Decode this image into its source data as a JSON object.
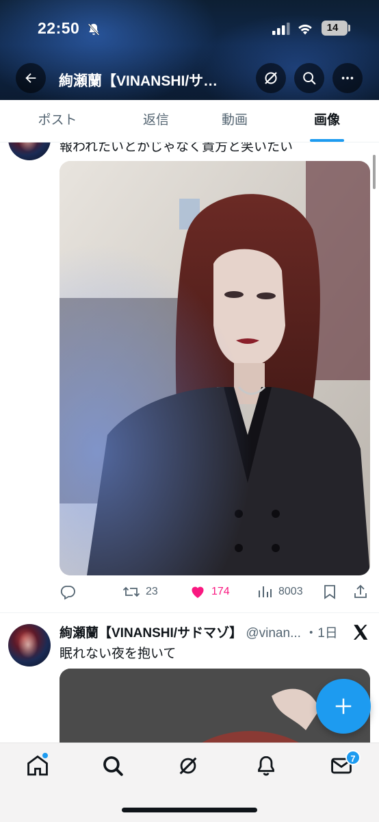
{
  "status_bar": {
    "time": "22:50",
    "battery": "14"
  },
  "header": {
    "title": "絢瀬蘭【VINANSHI/サ…",
    "icons": [
      "back-arrow-icon",
      "grok-icon",
      "search-icon",
      "more-icon"
    ]
  },
  "tabs": [
    {
      "label": "ポスト",
      "active": false
    },
    {
      "label": "返信",
      "active": false
    },
    {
      "label": "動画",
      "active": false
    },
    {
      "label": "画像",
      "active": true
    }
  ],
  "tweet1": {
    "text": "報われたいとかじゃなく貴方と笑いたい",
    "replies": "",
    "retweets": "23",
    "likes": "174",
    "views": "8003",
    "liked": true,
    "like_color": "#f91880"
  },
  "tweet2": {
    "name": "絢瀬蘭【VINANSHI/サドマゾ】",
    "handle": "@vinan...",
    "age": "・1日",
    "text": "眠れない夜を抱いて"
  },
  "bottom_nav": {
    "items": [
      "home-icon",
      "search-icon",
      "grok-icon",
      "notifications-icon",
      "messages-icon"
    ],
    "messages_badge": "7"
  },
  "colors": {
    "accent": "#1d9bf0",
    "text_primary": "#0f1419",
    "text_secondary": "#536471"
  }
}
